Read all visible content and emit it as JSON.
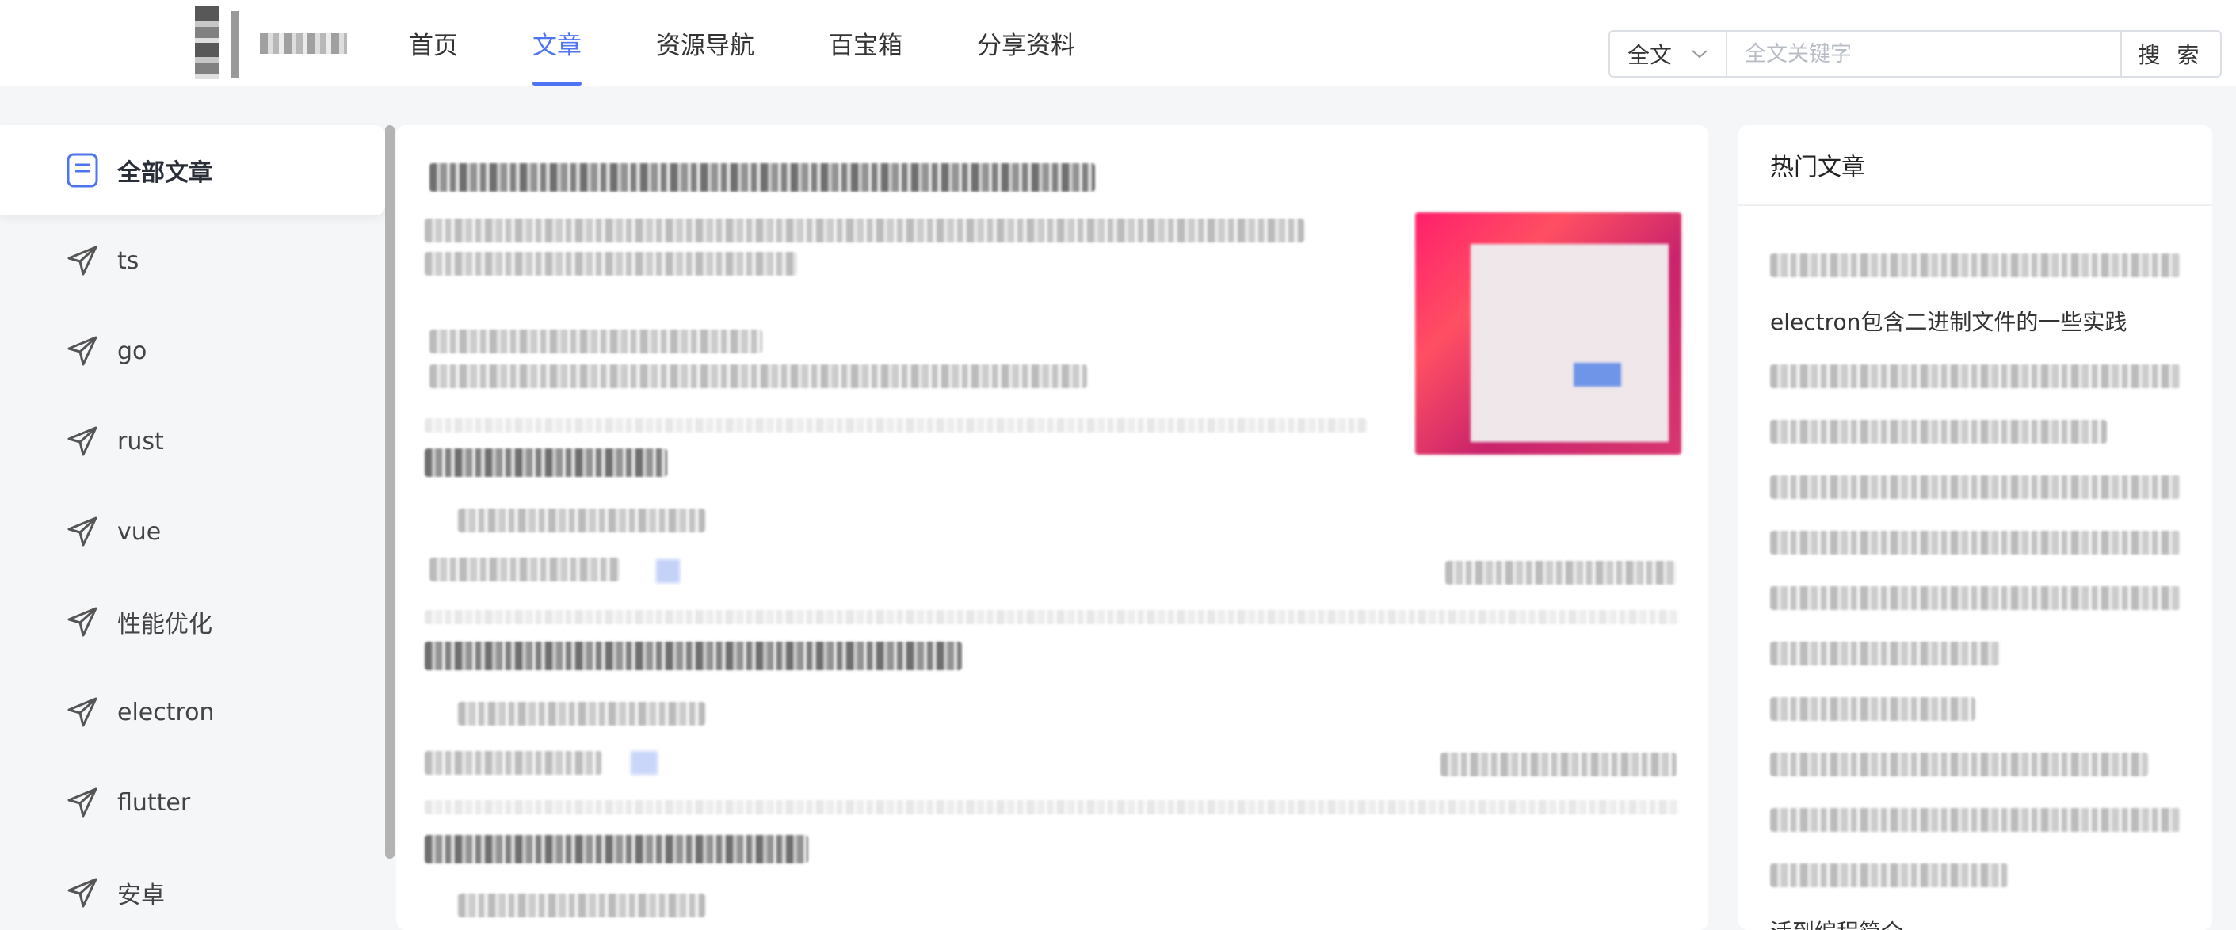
{
  "header": {
    "nav": [
      {
        "label": "首页",
        "active": false
      },
      {
        "label": "文章",
        "active": true
      },
      {
        "label": "资源导航",
        "active": false
      },
      {
        "label": "百宝箱",
        "active": false
      },
      {
        "label": "分享资料",
        "active": false
      }
    ],
    "search": {
      "type": "全文",
      "placeholder": "全文关键字",
      "button": "搜 索"
    }
  },
  "sidebar": {
    "items": [
      {
        "label": "全部文章",
        "icon": "document-icon",
        "active": true
      },
      {
        "label": "ts",
        "icon": "send-icon"
      },
      {
        "label": "go",
        "icon": "send-icon"
      },
      {
        "label": "rust",
        "icon": "send-icon"
      },
      {
        "label": "vue",
        "icon": "send-icon"
      },
      {
        "label": "性能优化",
        "icon": "send-icon"
      },
      {
        "label": "electron",
        "icon": "send-icon"
      },
      {
        "label": "flutter",
        "icon": "send-icon"
      },
      {
        "label": "安卓",
        "icon": "send-icon"
      }
    ]
  },
  "right": {
    "title": "热门文章",
    "items": [
      {
        "label": ""
      },
      {
        "label": "electron包含二进制文件的一些实践"
      },
      {
        "label": ""
      },
      {
        "label": ""
      },
      {
        "label": ""
      },
      {
        "label": ""
      },
      {
        "label": ""
      },
      {
        "label": ""
      },
      {
        "label": ""
      },
      {
        "label": ""
      },
      {
        "label": ""
      },
      {
        "label": ""
      },
      {
        "label": "活到编程简介"
      }
    ]
  },
  "colors": {
    "accent": "#4f74f2",
    "background": "#f5f6f8"
  }
}
